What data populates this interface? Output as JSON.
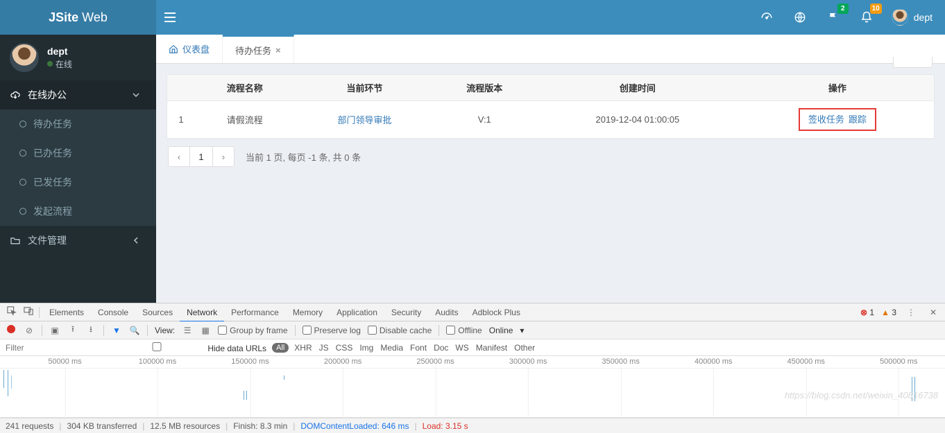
{
  "brand": {
    "strong": "JSite",
    "light": " Web"
  },
  "topbar": {
    "bell_badge": "2",
    "notify_badge": "10",
    "username": "dept"
  },
  "sidebar": {
    "user": {
      "name": "dept",
      "status": "在线"
    },
    "section_online": "在线办公",
    "items": [
      "待办任务",
      "已办任务",
      "已发任务",
      "发起流程"
    ],
    "section_files": "文件管理"
  },
  "tabs": {
    "dashboard": "仪表盘",
    "todo": "待办任务"
  },
  "table": {
    "headers": {
      "idx": "",
      "name": "流程名称",
      "step": "当前环节",
      "version": "流程版本",
      "created": "创建时间",
      "ops": "操作"
    },
    "rows": [
      {
        "idx": "1",
        "name": "请假流程",
        "step": "部门领导审批",
        "version": "V:1",
        "created": "2019-12-04 01:00:05",
        "op1": "签收任务",
        "op2": "跟踪"
      }
    ]
  },
  "pager": {
    "prev": "‹",
    "cur": "1",
    "next": "›",
    "summary": "当前  1  页, 每页  -1  条, 共 0 条"
  },
  "devtools": {
    "tabs": [
      "Elements",
      "Console",
      "Sources",
      "Network",
      "Performance",
      "Memory",
      "Application",
      "Security",
      "Audits",
      "Adblock Plus"
    ],
    "active_tab": "Network",
    "errors": "1",
    "warnings": "3",
    "toolbar": {
      "view": "View:",
      "group": "Group by frame",
      "preserve": "Preserve log",
      "disable_cache": "Disable cache",
      "offline": "Offline",
      "online": "Online"
    },
    "filter": {
      "placeholder": "Filter",
      "hide": "Hide data URLs",
      "all": "All",
      "types": [
        "XHR",
        "JS",
        "CSS",
        "Img",
        "Media",
        "Font",
        "Doc",
        "WS",
        "Manifest",
        "Other"
      ]
    },
    "timeline_ticks": [
      "50000 ms",
      "100000 ms",
      "150000 ms",
      "200000 ms",
      "250000 ms",
      "300000 ms",
      "350000 ms",
      "400000 ms",
      "450000 ms",
      "500000 ms"
    ],
    "status": {
      "requests": "241 requests",
      "transferred": "304 KB transferred",
      "resources": "12.5 MB resources",
      "finish": "Finish: 8.3 min",
      "dcl_label": "DOMContentLoaded: ",
      "dcl_val": "646 ms",
      "load_label": "Load: ",
      "load_val": "3.15 s"
    }
  },
  "watermark": "https://blog.csdn.net/weixin_40816738"
}
